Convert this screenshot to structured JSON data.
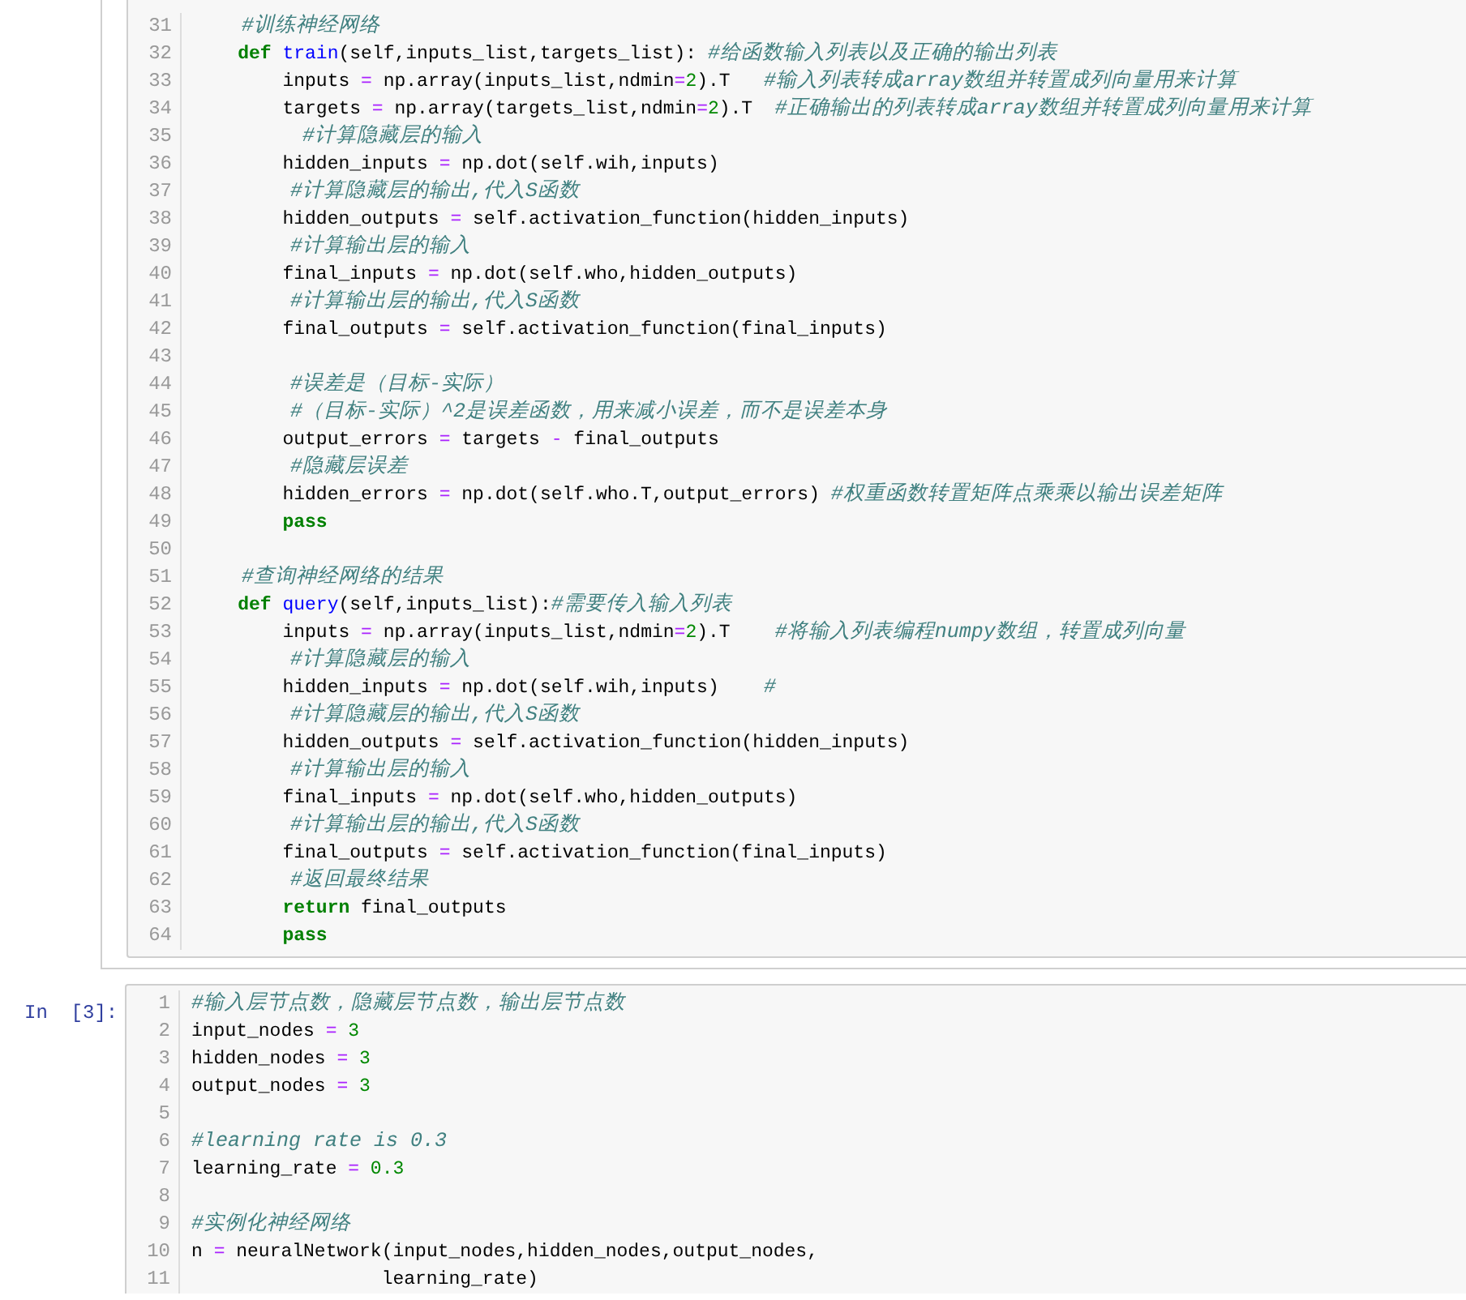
{
  "cells": [
    {
      "lines": [
        {
          "no": "31",
          "tokens": [
            {
              "kind": "comment",
              "text": "    #训练神经网络"
            }
          ]
        },
        {
          "no": "32",
          "tokens": [
            {
              "kind": "keyword",
              "text": "    def"
            },
            {
              "kind": "name",
              "text": " train"
            },
            {
              "kind": "text",
              "text": "(self,inputs_list,targets_list): "
            },
            {
              "kind": "comment",
              "text": "#给函数输入列表以及正确的输出列表"
            }
          ]
        },
        {
          "no": "33",
          "tokens": [
            {
              "kind": "text",
              "text": "        inputs "
            },
            {
              "kind": "op",
              "text": "="
            },
            {
              "kind": "text",
              "text": " np.array(inputs_list,ndmin"
            },
            {
              "kind": "op",
              "text": "="
            },
            {
              "kind": "num",
              "text": "2"
            },
            {
              "kind": "text",
              "text": ").T   "
            },
            {
              "kind": "comment",
              "text": "#输入列表转成array数组并转置成列向量用来计算"
            }
          ]
        },
        {
          "no": "34",
          "tokens": [
            {
              "kind": "text",
              "text": "        targets "
            },
            {
              "kind": "op",
              "text": "="
            },
            {
              "kind": "text",
              "text": " np.array(targets_list,ndmin"
            },
            {
              "kind": "op",
              "text": "="
            },
            {
              "kind": "num",
              "text": "2"
            },
            {
              "kind": "text",
              "text": ").T  "
            },
            {
              "kind": "comment",
              "text": "#正确输出的列表转成array数组并转置成列向量用来计算"
            }
          ]
        },
        {
          "no": "35",
          "tokens": [
            {
              "kind": "comment",
              "text": "         #计算隐藏层的输入"
            }
          ]
        },
        {
          "no": "36",
          "tokens": [
            {
              "kind": "text",
              "text": "        hidden_inputs "
            },
            {
              "kind": "op",
              "text": "="
            },
            {
              "kind": "text",
              "text": " np.dot(self.wih,inputs)"
            }
          ]
        },
        {
          "no": "37",
          "tokens": [
            {
              "kind": "comment",
              "text": "        #计算隐藏层的输出,代入S函数"
            }
          ]
        },
        {
          "no": "38",
          "tokens": [
            {
              "kind": "text",
              "text": "        hidden_outputs "
            },
            {
              "kind": "op",
              "text": "="
            },
            {
              "kind": "text",
              "text": " self.activation_function(hidden_inputs)"
            }
          ]
        },
        {
          "no": "39",
          "tokens": [
            {
              "kind": "comment",
              "text": "        #计算输出层的输入"
            }
          ]
        },
        {
          "no": "40",
          "tokens": [
            {
              "kind": "text",
              "text": "        final_inputs "
            },
            {
              "kind": "op",
              "text": "="
            },
            {
              "kind": "text",
              "text": " np.dot(self.who,hidden_outputs)"
            }
          ]
        },
        {
          "no": "41",
          "tokens": [
            {
              "kind": "comment",
              "text": "        #计算输出层的输出,代入S函数"
            }
          ]
        },
        {
          "no": "42",
          "tokens": [
            {
              "kind": "text",
              "text": "        final_outputs "
            },
            {
              "kind": "op",
              "text": "="
            },
            {
              "kind": "text",
              "text": " self.activation_function(final_inputs)"
            }
          ]
        },
        {
          "no": "43"
        },
        {
          "no": "44",
          "tokens": [
            {
              "kind": "comment",
              "text": "        #误差是（目标-实际）"
            }
          ]
        },
        {
          "no": "45",
          "tokens": [
            {
              "kind": "comment",
              "text": "        #（目标-实际）^2是误差函数，用来减小误差，而不是误差本身"
            }
          ]
        },
        {
          "no": "46",
          "tokens": [
            {
              "kind": "text",
              "text": "        output_errors "
            },
            {
              "kind": "op",
              "text": "="
            },
            {
              "kind": "text",
              "text": " targets "
            },
            {
              "kind": "op",
              "text": "-"
            },
            {
              "kind": "text",
              "text": " final_outputs"
            }
          ]
        },
        {
          "no": "47",
          "tokens": [
            {
              "kind": "comment",
              "text": "        #隐藏层误差"
            }
          ]
        },
        {
          "no": "48",
          "tokens": [
            {
              "kind": "text",
              "text": "        hidden_errors "
            },
            {
              "kind": "op",
              "text": "="
            },
            {
              "kind": "text",
              "text": " np.dot(self.who.T,output_errors) "
            },
            {
              "kind": "comment",
              "text": "#权重函数转置矩阵点乘乘以输出误差矩阵"
            }
          ]
        },
        {
          "no": "49",
          "tokens": [
            {
              "kind": "keyword",
              "text": "        pass"
            }
          ]
        },
        {
          "no": "50"
        },
        {
          "no": "51",
          "tokens": [
            {
              "kind": "comment",
              "text": "    #查询神经网络的结果"
            }
          ]
        },
        {
          "no": "52",
          "tokens": [
            {
              "kind": "keyword",
              "text": "    def"
            },
            {
              "kind": "name",
              "text": " query"
            },
            {
              "kind": "text",
              "text": "(self,inputs_list):"
            },
            {
              "kind": "comment",
              "text": "#需要传入输入列表"
            }
          ]
        },
        {
          "no": "53",
          "tokens": [
            {
              "kind": "text",
              "text": "        inputs "
            },
            {
              "kind": "op",
              "text": "="
            },
            {
              "kind": "text",
              "text": " np.array(inputs_list,ndmin"
            },
            {
              "kind": "op",
              "text": "="
            },
            {
              "kind": "num",
              "text": "2"
            },
            {
              "kind": "text",
              "text": ").T    "
            },
            {
              "kind": "comment",
              "text": "#将输入列表编程numpy数组，转置成列向量"
            }
          ]
        },
        {
          "no": "54",
          "tokens": [
            {
              "kind": "comment",
              "text": "        #计算隐藏层的输入"
            }
          ]
        },
        {
          "no": "55",
          "tokens": [
            {
              "kind": "text",
              "text": "        hidden_inputs "
            },
            {
              "kind": "op",
              "text": "="
            },
            {
              "kind": "text",
              "text": " np.dot(self.wih,inputs)    "
            },
            {
              "kind": "comment",
              "text": "#"
            }
          ]
        },
        {
          "no": "56",
          "tokens": [
            {
              "kind": "comment",
              "text": "        #计算隐藏层的输出,代入S函数"
            }
          ]
        },
        {
          "no": "57",
          "tokens": [
            {
              "kind": "text",
              "text": "        hidden_outputs "
            },
            {
              "kind": "op",
              "text": "="
            },
            {
              "kind": "text",
              "text": " self.activation_function(hidden_inputs)"
            }
          ]
        },
        {
          "no": "58",
          "tokens": [
            {
              "kind": "comment",
              "text": "        #计算输出层的输入"
            }
          ]
        },
        {
          "no": "59",
          "tokens": [
            {
              "kind": "text",
              "text": "        final_inputs "
            },
            {
              "kind": "op",
              "text": "="
            },
            {
              "kind": "text",
              "text": " np.dot(self.who,hidden_outputs)"
            }
          ]
        },
        {
          "no": "60",
          "tokens": [
            {
              "kind": "comment",
              "text": "        #计算输出层的输出,代入S函数"
            }
          ]
        },
        {
          "no": "61",
          "tokens": [
            {
              "kind": "text",
              "text": "        final_outputs "
            },
            {
              "kind": "op",
              "text": "="
            },
            {
              "kind": "text",
              "text": " self.activation_function(final_inputs)"
            }
          ]
        },
        {
          "no": "62",
          "tokens": [
            {
              "kind": "comment",
              "text": "        #返回最终结果"
            }
          ]
        },
        {
          "no": "63",
          "tokens": [
            {
              "kind": "keyword",
              "text": "        return"
            },
            {
              "kind": "text",
              "text": " final_outputs"
            }
          ]
        },
        {
          "no": "64",
          "tokens": [
            {
              "kind": "keyword",
              "text": "        pass"
            }
          ]
        }
      ]
    },
    {
      "prompt": "In  [3]:",
      "lines": [
        {
          "no": "1",
          "tokens": [
            {
              "kind": "comment",
              "text": "#输入层节点数，隐藏层节点数，输出层节点数"
            }
          ]
        },
        {
          "no": "2",
          "tokens": [
            {
              "kind": "text",
              "text": "input_nodes "
            },
            {
              "kind": "op",
              "text": "="
            },
            {
              "kind": "num",
              "text": " 3"
            }
          ]
        },
        {
          "no": "3",
          "tokens": [
            {
              "kind": "text",
              "text": "hidden_nodes "
            },
            {
              "kind": "op",
              "text": "="
            },
            {
              "kind": "num",
              "text": " 3"
            }
          ]
        },
        {
          "no": "4",
          "tokens": [
            {
              "kind": "text",
              "text": "output_nodes "
            },
            {
              "kind": "op",
              "text": "="
            },
            {
              "kind": "num",
              "text": " 3"
            }
          ]
        },
        {
          "no": "5"
        },
        {
          "no": "6",
          "tokens": [
            {
              "kind": "comment",
              "text": "#learning rate is 0.3"
            }
          ]
        },
        {
          "no": "7",
          "tokens": [
            {
              "kind": "text",
              "text": "learning_rate "
            },
            {
              "kind": "op",
              "text": "="
            },
            {
              "kind": "num",
              "text": " 0.3"
            }
          ]
        },
        {
          "no": "8"
        },
        {
          "no": "9",
          "tokens": [
            {
              "kind": "comment",
              "text": "#实例化神经网络"
            }
          ]
        },
        {
          "no": "10",
          "tokens": [
            {
              "kind": "text",
              "text": "n "
            },
            {
              "kind": "op",
              "text": "="
            },
            {
              "kind": "text",
              "text": " neuralNetwork(input_nodes,hidden_nodes,output_nodes,"
            }
          ]
        },
        {
          "no": "11",
          "tokens": [
            {
              "kind": "text",
              "text": "                 learning_rate)"
            }
          ]
        }
      ]
    }
  ]
}
